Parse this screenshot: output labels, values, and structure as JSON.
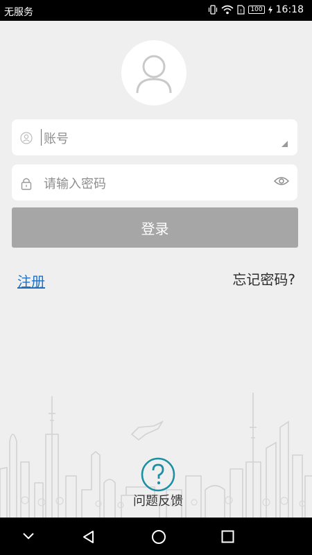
{
  "status_bar": {
    "carrier": "无服务",
    "battery": "100",
    "time": "16:18"
  },
  "login": {
    "account_placeholder": "账号",
    "password_placeholder": "请输入密码",
    "login_label": "登录",
    "register_label": "注册",
    "forgot_label": "忘记密码?"
  },
  "feedback": {
    "label": "问题反馈"
  },
  "colors": {
    "login_button_bg": "#a6a6a6",
    "link_blue": "#1f70c1",
    "feedback_teal": "#1a8fa3"
  },
  "icons": [
    "vibrate-icon",
    "wifi-icon",
    "sim-icon",
    "battery-icon",
    "charging-icon",
    "avatar-icon",
    "user-icon",
    "lock-icon",
    "eye-icon",
    "question-icon",
    "back-icon",
    "home-icon",
    "recents-icon",
    "collapse-icon"
  ]
}
